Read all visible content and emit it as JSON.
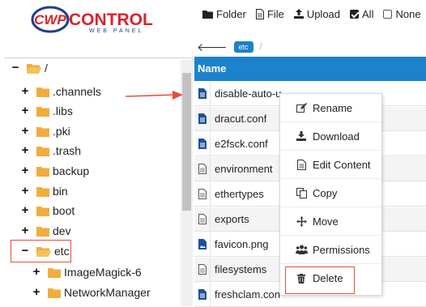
{
  "logo": {
    "mark": "CWP",
    "name": "CONTROL",
    "tagline": "WEB PANEL"
  },
  "toolbar": {
    "folder_label": "Folder",
    "file_label": "File",
    "upload_label": "Upload",
    "all_label": "All",
    "none_label": "None",
    "all_checked": true,
    "none_checked": false
  },
  "pathbar": {
    "crumb": "etc",
    "separator": "/"
  },
  "tree": {
    "root": {
      "label": "/",
      "toggle": "−"
    },
    "items": [
      {
        "label": ".channels",
        "toggle": "+"
      },
      {
        "label": ".libs",
        "toggle": "+"
      },
      {
        "label": ".pki",
        "toggle": "+"
      },
      {
        "label": ".trash",
        "toggle": "+"
      },
      {
        "label": "backup",
        "toggle": "+"
      },
      {
        "label": "bin",
        "toggle": "+"
      },
      {
        "label": "boot",
        "toggle": "+"
      },
      {
        "label": "dev",
        "toggle": "+"
      },
      {
        "label": "etc",
        "toggle": "−"
      }
    ],
    "children": [
      {
        "label": "ImageMagick-6",
        "toggle": "+"
      },
      {
        "label": "NetworkManager",
        "toggle": "+"
      }
    ]
  },
  "files": {
    "header": "Name",
    "rows": [
      {
        "name": "disable-auto-u"
      },
      {
        "name": "dracut.conf"
      },
      {
        "name": "e2fsck.conf"
      },
      {
        "name": "environment"
      },
      {
        "name": "ethertypes"
      },
      {
        "name": "exports"
      },
      {
        "name": "favicon.png"
      },
      {
        "name": "filesystems"
      },
      {
        "name": "freshclam.con"
      }
    ]
  },
  "context_menu": {
    "items": [
      {
        "label": "Rename",
        "icon": "edit-icon"
      },
      {
        "label": "Download",
        "icon": "download-icon"
      },
      {
        "label": "Edit Content",
        "icon": "edit-content-icon"
      },
      {
        "label": "Copy",
        "icon": "copy-icon"
      },
      {
        "label": "Move",
        "icon": "move-icon"
      },
      {
        "label": "Permissions",
        "icon": "users-icon"
      },
      {
        "label": "Delete",
        "icon": "trash-icon"
      }
    ]
  },
  "colors": {
    "accent": "#1d82cc",
    "folder": "#f0ad3c",
    "annotation": "#e94a3c",
    "logo_red": "#d9232d",
    "logo_blue": "#1e3f8a"
  }
}
